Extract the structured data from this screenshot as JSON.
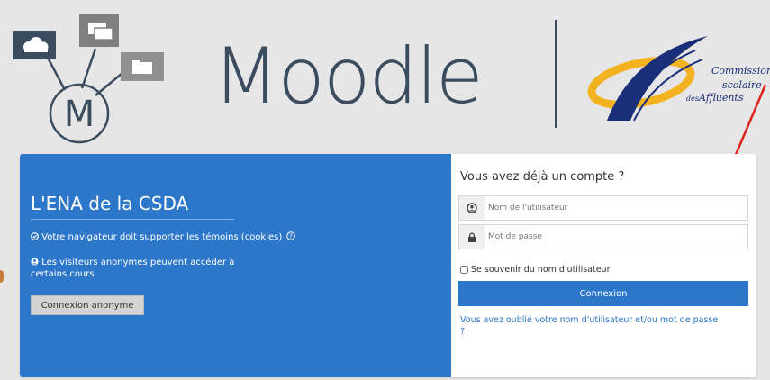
{
  "banner": {
    "logo_word": "Moodle",
    "logo_letter": "M",
    "commission": {
      "line1": "Commission",
      "line2": "scolaire",
      "line3_prefix": "des",
      "line3_main": "Affluents"
    }
  },
  "left_panel": {
    "title": "L'ENA de la CSDA",
    "cookies_notice": "Votre navigateur doit supporter les témoins (cookies)",
    "guest_notice_line1": "Les visiteurs anonymes peuvent accéder à",
    "guest_notice_line2": "certains cours",
    "guest_button": "Connexion anonyme"
  },
  "login": {
    "heading": "Vous avez déjà un compte ?",
    "username_placeholder": "Nom de l'utilisateur",
    "password_placeholder": "Mot de passe",
    "remember_label": "Se souvenir du nom d'utilisateur",
    "submit": "Connexion",
    "forgot_line1": "Vous avez oublié votre nom d'utilisateur et/ou mot de passe",
    "forgot_line2": "?"
  },
  "colors": {
    "primary_blue": "#2c77c9",
    "moodle_text": "#3b4c5e",
    "annotation_arrow": "#e0201b",
    "cs_gold": "#f3b321",
    "cs_navy": "#1a2f7a"
  },
  "icons": [
    "cloud-icon",
    "chat-icon",
    "folder-icon",
    "user-circle-icon",
    "lock-icon",
    "check-circle-icon",
    "help-icon",
    "user-icon"
  ]
}
